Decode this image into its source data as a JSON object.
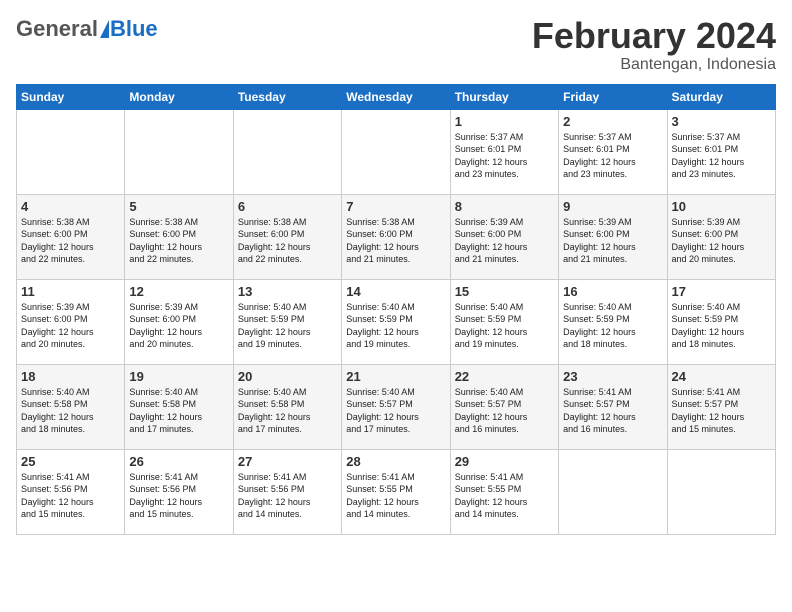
{
  "header": {
    "logo": {
      "general": "General",
      "blue": "Blue",
      "tagline": ""
    },
    "title": "February 2024",
    "location": "Bantengan, Indonesia"
  },
  "weekdays": [
    "Sunday",
    "Monday",
    "Tuesday",
    "Wednesday",
    "Thursday",
    "Friday",
    "Saturday"
  ],
  "weeks": [
    [
      {
        "day": "",
        "info": ""
      },
      {
        "day": "",
        "info": ""
      },
      {
        "day": "",
        "info": ""
      },
      {
        "day": "",
        "info": ""
      },
      {
        "day": "1",
        "info": "Sunrise: 5:37 AM\nSunset: 6:01 PM\nDaylight: 12 hours\nand 23 minutes."
      },
      {
        "day": "2",
        "info": "Sunrise: 5:37 AM\nSunset: 6:01 PM\nDaylight: 12 hours\nand 23 minutes."
      },
      {
        "day": "3",
        "info": "Sunrise: 5:37 AM\nSunset: 6:01 PM\nDaylight: 12 hours\nand 23 minutes."
      }
    ],
    [
      {
        "day": "4",
        "info": "Sunrise: 5:38 AM\nSunset: 6:00 PM\nDaylight: 12 hours\nand 22 minutes."
      },
      {
        "day": "5",
        "info": "Sunrise: 5:38 AM\nSunset: 6:00 PM\nDaylight: 12 hours\nand 22 minutes."
      },
      {
        "day": "6",
        "info": "Sunrise: 5:38 AM\nSunset: 6:00 PM\nDaylight: 12 hours\nand 22 minutes."
      },
      {
        "day": "7",
        "info": "Sunrise: 5:38 AM\nSunset: 6:00 PM\nDaylight: 12 hours\nand 21 minutes."
      },
      {
        "day": "8",
        "info": "Sunrise: 5:39 AM\nSunset: 6:00 PM\nDaylight: 12 hours\nand 21 minutes."
      },
      {
        "day": "9",
        "info": "Sunrise: 5:39 AM\nSunset: 6:00 PM\nDaylight: 12 hours\nand 21 minutes."
      },
      {
        "day": "10",
        "info": "Sunrise: 5:39 AM\nSunset: 6:00 PM\nDaylight: 12 hours\nand 20 minutes."
      }
    ],
    [
      {
        "day": "11",
        "info": "Sunrise: 5:39 AM\nSunset: 6:00 PM\nDaylight: 12 hours\nand 20 minutes."
      },
      {
        "day": "12",
        "info": "Sunrise: 5:39 AM\nSunset: 6:00 PM\nDaylight: 12 hours\nand 20 minutes."
      },
      {
        "day": "13",
        "info": "Sunrise: 5:40 AM\nSunset: 5:59 PM\nDaylight: 12 hours\nand 19 minutes."
      },
      {
        "day": "14",
        "info": "Sunrise: 5:40 AM\nSunset: 5:59 PM\nDaylight: 12 hours\nand 19 minutes."
      },
      {
        "day": "15",
        "info": "Sunrise: 5:40 AM\nSunset: 5:59 PM\nDaylight: 12 hours\nand 19 minutes."
      },
      {
        "day": "16",
        "info": "Sunrise: 5:40 AM\nSunset: 5:59 PM\nDaylight: 12 hours\nand 18 minutes."
      },
      {
        "day": "17",
        "info": "Sunrise: 5:40 AM\nSunset: 5:59 PM\nDaylight: 12 hours\nand 18 minutes."
      }
    ],
    [
      {
        "day": "18",
        "info": "Sunrise: 5:40 AM\nSunset: 5:58 PM\nDaylight: 12 hours\nand 18 minutes."
      },
      {
        "day": "19",
        "info": "Sunrise: 5:40 AM\nSunset: 5:58 PM\nDaylight: 12 hours\nand 17 minutes."
      },
      {
        "day": "20",
        "info": "Sunrise: 5:40 AM\nSunset: 5:58 PM\nDaylight: 12 hours\nand 17 minutes."
      },
      {
        "day": "21",
        "info": "Sunrise: 5:40 AM\nSunset: 5:57 PM\nDaylight: 12 hours\nand 17 minutes."
      },
      {
        "day": "22",
        "info": "Sunrise: 5:40 AM\nSunset: 5:57 PM\nDaylight: 12 hours\nand 16 minutes."
      },
      {
        "day": "23",
        "info": "Sunrise: 5:41 AM\nSunset: 5:57 PM\nDaylight: 12 hours\nand 16 minutes."
      },
      {
        "day": "24",
        "info": "Sunrise: 5:41 AM\nSunset: 5:57 PM\nDaylight: 12 hours\nand 15 minutes."
      }
    ],
    [
      {
        "day": "25",
        "info": "Sunrise: 5:41 AM\nSunset: 5:56 PM\nDaylight: 12 hours\nand 15 minutes."
      },
      {
        "day": "26",
        "info": "Sunrise: 5:41 AM\nSunset: 5:56 PM\nDaylight: 12 hours\nand 15 minutes."
      },
      {
        "day": "27",
        "info": "Sunrise: 5:41 AM\nSunset: 5:56 PM\nDaylight: 12 hours\nand 14 minutes."
      },
      {
        "day": "28",
        "info": "Sunrise: 5:41 AM\nSunset: 5:55 PM\nDaylight: 12 hours\nand 14 minutes."
      },
      {
        "day": "29",
        "info": "Sunrise: 5:41 AM\nSunset: 5:55 PM\nDaylight: 12 hours\nand 14 minutes."
      },
      {
        "day": "",
        "info": ""
      },
      {
        "day": "",
        "info": ""
      }
    ]
  ]
}
